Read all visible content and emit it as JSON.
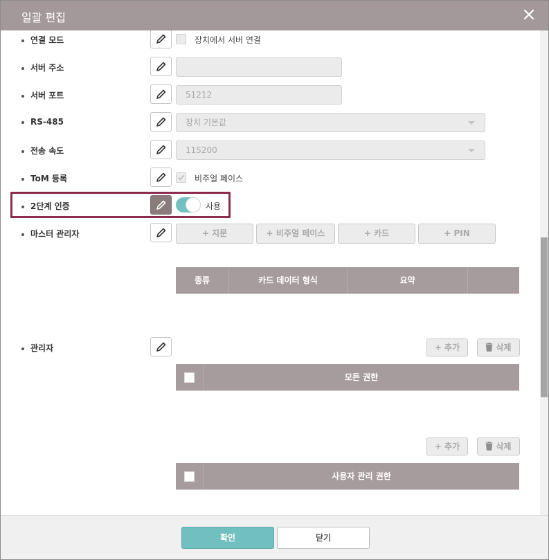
{
  "dialog": {
    "title": "일괄 편집",
    "close_icon": "close-icon"
  },
  "rows": {
    "connection_mode": {
      "label": "연결 모드",
      "checkbox_label": "장치에서 서버 연결",
      "checked": false
    },
    "server_address": {
      "label": "서버 주소",
      "value": ""
    },
    "server_port": {
      "label": "서버 포트",
      "value": "51212"
    },
    "rs485": {
      "label": "RS-485",
      "value": "장치 기본값"
    },
    "baud_rate": {
      "label": "전송 속도",
      "value": "115200"
    },
    "tom": {
      "label": "ToM 등록",
      "checkbox_label": "비주얼 페이스",
      "checked": true
    },
    "two_factor": {
      "label": "2단계 인증",
      "toggle_label": "사용",
      "enabled": true
    },
    "master_admin": {
      "label": "마스터 관리자",
      "buttons": [
        "+ 지문",
        "+ 비주얼 페이스",
        "+ 카드",
        "+ PIN"
      ],
      "table_headers": [
        "종류",
        "카드 데이터 형식",
        "요약",
        ""
      ]
    },
    "admin": {
      "label": "관리자",
      "add_label": "+ 추가",
      "delete_label": "삭제",
      "all_perm_header": "모든 권한",
      "user_perm_header": "사용자 관리 권한"
    }
  },
  "footer": {
    "confirm_label": "확인",
    "close_label": "닫기"
  },
  "colors": {
    "title_bar": "#a4999a",
    "accent": "#72c2c3",
    "highlight_border": "#8c2c4f",
    "table_header": "#a69c9d"
  }
}
